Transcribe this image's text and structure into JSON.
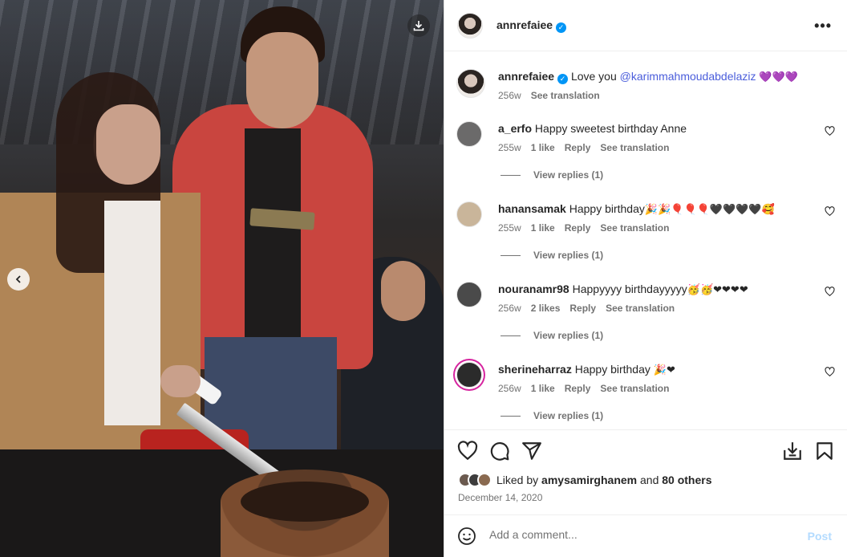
{
  "post": {
    "author": "annrefaiee",
    "caption_text": "Love you ",
    "caption_mention": "@karimmahmoudabdelaziz",
    "caption_emoji": "💜💜💜",
    "caption_time": "256w",
    "see_translation": "See translation",
    "liked_by_prefix": "Liked by ",
    "liked_by_user": "amysamirghanem",
    "liked_by_and": " and ",
    "liked_by_others": "80 others",
    "date": "December 14, 2020"
  },
  "comments": [
    {
      "username": "a_erfo",
      "text": "Happy sweetest birthday Anne",
      "emoji": "",
      "time": "255w",
      "likes": "1 like",
      "reply": "Reply",
      "translate": "See translation",
      "view_replies": "View replies (1)",
      "avatar_color": "#6b6a6a"
    },
    {
      "username": "hanansamak",
      "text": "Happy birthday",
      "emoji": "🎉🎉🎈🎈🎈🖤🖤🖤🖤🥰",
      "time": "255w",
      "likes": "1 like",
      "reply": "Reply",
      "translate": "See translation",
      "view_replies": "View replies (1)",
      "avatar_color": "#c9b59a"
    },
    {
      "username": "nouranamr98",
      "text": "Happyyyy birthdayyyyy",
      "emoji": "🥳🥳❤❤❤❤",
      "time": "256w",
      "likes": "2 likes",
      "reply": "Reply",
      "translate": "See translation",
      "view_replies": "View replies (1)",
      "avatar_color": "#4a4a4a"
    },
    {
      "username": "sherineharraz",
      "text": "Happy birthday",
      "emoji": "🎉❤",
      "time": "256w",
      "likes": "1 like",
      "reply": "Reply",
      "translate": "See translation",
      "view_replies": "View replies (1)",
      "avatar_color": "#2b2b2b"
    }
  ],
  "composer": {
    "placeholder": "Add a comment...",
    "post_label": "Post"
  },
  "colors": {
    "verified": "#0095f6",
    "mention": "#4a5ddb",
    "secondary_text": "#737373",
    "post_disabled": "#b3dbff",
    "heart_red": "#ed4956"
  },
  "icons": [
    "download-icon",
    "chevron-left-icon",
    "verified-icon",
    "more-icon",
    "heart-icon",
    "comment-icon",
    "share-icon",
    "save-icon",
    "bookmark-icon",
    "emoji-icon"
  ]
}
